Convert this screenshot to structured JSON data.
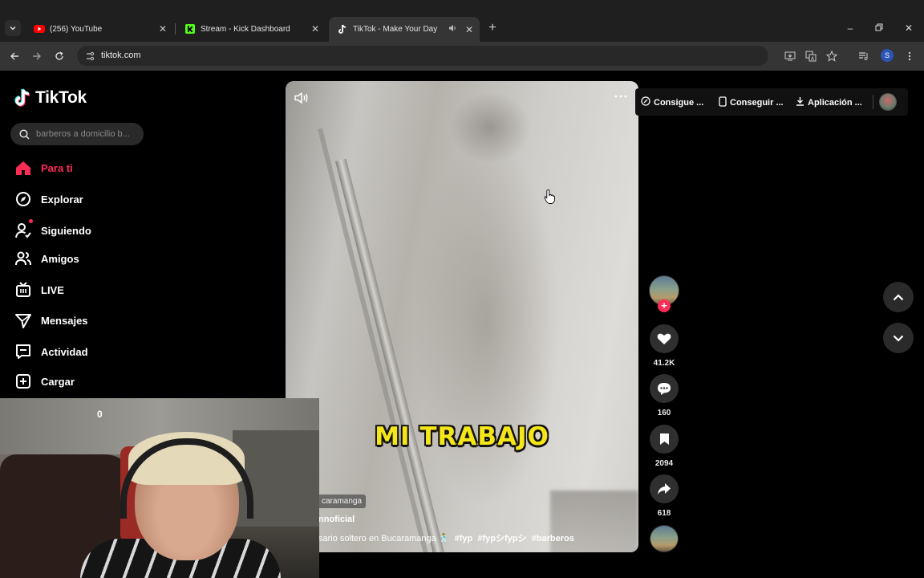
{
  "browser": {
    "tabs": [
      {
        "title": "(256) YouTube",
        "icon": "youtube-icon",
        "active": false
      },
      {
        "title": "Stream - Kick Dashboard",
        "icon": "kick-icon",
        "active": false
      },
      {
        "title": "TikTok - Make Your Day",
        "icon": "tiktok-icon",
        "active": true
      }
    ],
    "url": "tiktok.com",
    "profile_initial": "S"
  },
  "tiktok": {
    "logo": "TikTok",
    "search": {
      "placeholder": "barberos a domicilio b..."
    },
    "nav": [
      {
        "label": "Para ti",
        "icon": "home-icon",
        "active": true
      },
      {
        "label": "Explorar",
        "icon": "compass-icon"
      },
      {
        "label": "Siguiendo",
        "icon": "following-icon",
        "badge": true
      },
      {
        "label": "Amigos",
        "icon": "friends-icon"
      },
      {
        "label": "LIVE",
        "icon": "live-icon"
      },
      {
        "label": "Mensajes",
        "icon": "messages-icon"
      },
      {
        "label": "Actividad",
        "icon": "activity-icon"
      },
      {
        "label": "Cargar",
        "icon": "upload-icon"
      }
    ],
    "top_links": [
      {
        "label": "Consigue ...",
        "icon": "coin-icon"
      },
      {
        "label": "Conseguir ...",
        "icon": "phone-icon"
      },
      {
        "label": "Aplicación ...",
        "icon": "download-icon"
      }
    ],
    "video": {
      "caption": "MI TRABAJO",
      "location_tag": "caramanga",
      "author": "nnoficial",
      "description_text": "sario soltero en Bucaramanga 🕺",
      "hashtags": [
        "#fyp",
        "#fypシfypシ",
        "#barberos"
      ]
    },
    "actions": {
      "likes": "41.2K",
      "comments": "160",
      "saves": "2094",
      "shares": "618"
    }
  },
  "webcam": {
    "counter": "0"
  },
  "colors": {
    "accent": "#fe2c55",
    "caption_yellow": "#f5e61a",
    "chrome_dark": "#1f1f1f",
    "chrome_toolbar": "#353535"
  }
}
